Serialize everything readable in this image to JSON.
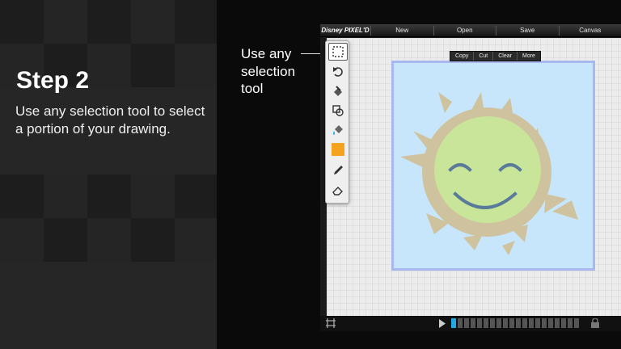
{
  "instructions": {
    "step_title": "Step 2",
    "step_description": "Use any selection tool to select a portion of your drawing."
  },
  "callout": {
    "lines": [
      "Use any",
      "selection",
      "tool"
    ]
  },
  "app": {
    "logo": "Disney PIXEL'D",
    "menu": [
      "New",
      "Open",
      "Save",
      "Canvas"
    ],
    "selection_toolbar": [
      "Copy",
      "Cut",
      "Clear",
      "More"
    ],
    "tools": [
      {
        "icon": "selection-marquee-icon",
        "active": true
      },
      {
        "icon": "undo-icon",
        "active": false
      },
      {
        "icon": "stamp-icon",
        "active": false
      },
      {
        "icon": "shapes-icon",
        "active": false
      },
      {
        "icon": "paint-bucket-icon",
        "active": false
      },
      {
        "icon": "color-swatch-icon",
        "active": false
      },
      {
        "icon": "pencil-icon",
        "active": false
      },
      {
        "icon": "eraser-icon",
        "active": false
      }
    ],
    "current_color": "#f5a21f",
    "frame_count": 20,
    "current_frame": 1
  },
  "colors": {
    "sky": "#c8e6fb",
    "frame_border": "#a8b8ee",
    "sun_face": "#c8e59a",
    "sun_rays": "#cfc29e",
    "smile": "#5a7a9a",
    "frame_highlight": "#22a9e6"
  }
}
